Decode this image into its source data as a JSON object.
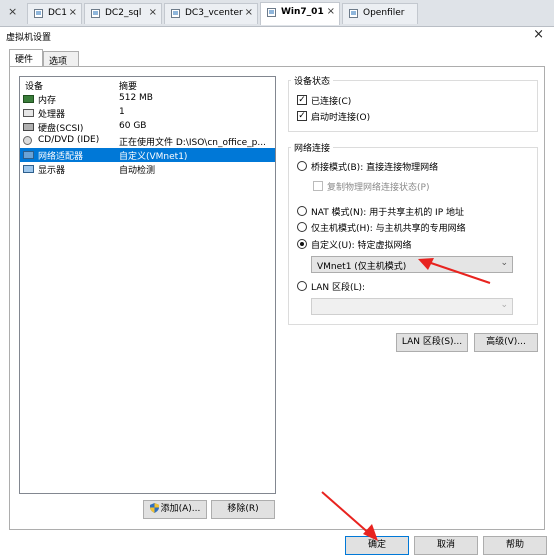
{
  "tabs": [
    {
      "label": "DC1"
    },
    {
      "label": "DC2_sql"
    },
    {
      "label": "DC3_vcenter"
    },
    {
      "label": "Win7_01"
    },
    {
      "label": "Openfiler"
    }
  ],
  "tab_close_glyph": "×",
  "dialog": {
    "title": "虚拟机设置",
    "close_glyph": "×",
    "hw_tab": "硬件",
    "options_tab": "选项"
  },
  "device_list": {
    "col_device": "设备",
    "col_summary": "摘要",
    "rows": [
      {
        "name": "内存",
        "summary": "512 MB",
        "icon": "memory-icon"
      },
      {
        "name": "处理器",
        "summary": "1",
        "icon": "processor-icon"
      },
      {
        "name": "硬盘(SCSI)",
        "summary": "60 GB",
        "icon": "harddisk-icon"
      },
      {
        "name": "CD/DVD (IDE)",
        "summary": "正在使用文件 D:\\ISO\\cn_office_p...",
        "icon": "cd-dvd-icon"
      },
      {
        "name": "网络适配器",
        "summary": "自定义(VMnet1)",
        "icon": "network-adapter-icon"
      },
      {
        "name": "显示器",
        "summary": "自动检测",
        "icon": "display-icon"
      }
    ],
    "selected_index": 4
  },
  "buttons": {
    "add": "添加(A)...",
    "remove": "移除(R)",
    "lan_segments": "LAN 区段(S)...",
    "advanced": "高级(V)...",
    "ok": "确定",
    "cancel": "取消",
    "help": "帮助"
  },
  "device_status": {
    "title": "设备状态",
    "connected": "已连接(C)",
    "connect_at_power_on": "启动时连接(O)"
  },
  "network_connection": {
    "title": "网络连接",
    "bridged": "桥接模式(B): 直接连接物理网络",
    "replicate": "复制物理网络连接状态(P)",
    "nat": "NAT 模式(N): 用于共享主机的 IP 地址",
    "host_only": "仅主机模式(H): 与主机共享的专用网络",
    "custom": "自定义(U): 特定虚拟网络",
    "custom_value": "VMnet1 (仅主机模式)",
    "lan_segment": "LAN 区段(L):",
    "lan_value": ""
  },
  "colors": {
    "selection": "#0078d7",
    "annotation": "#e8231f"
  }
}
